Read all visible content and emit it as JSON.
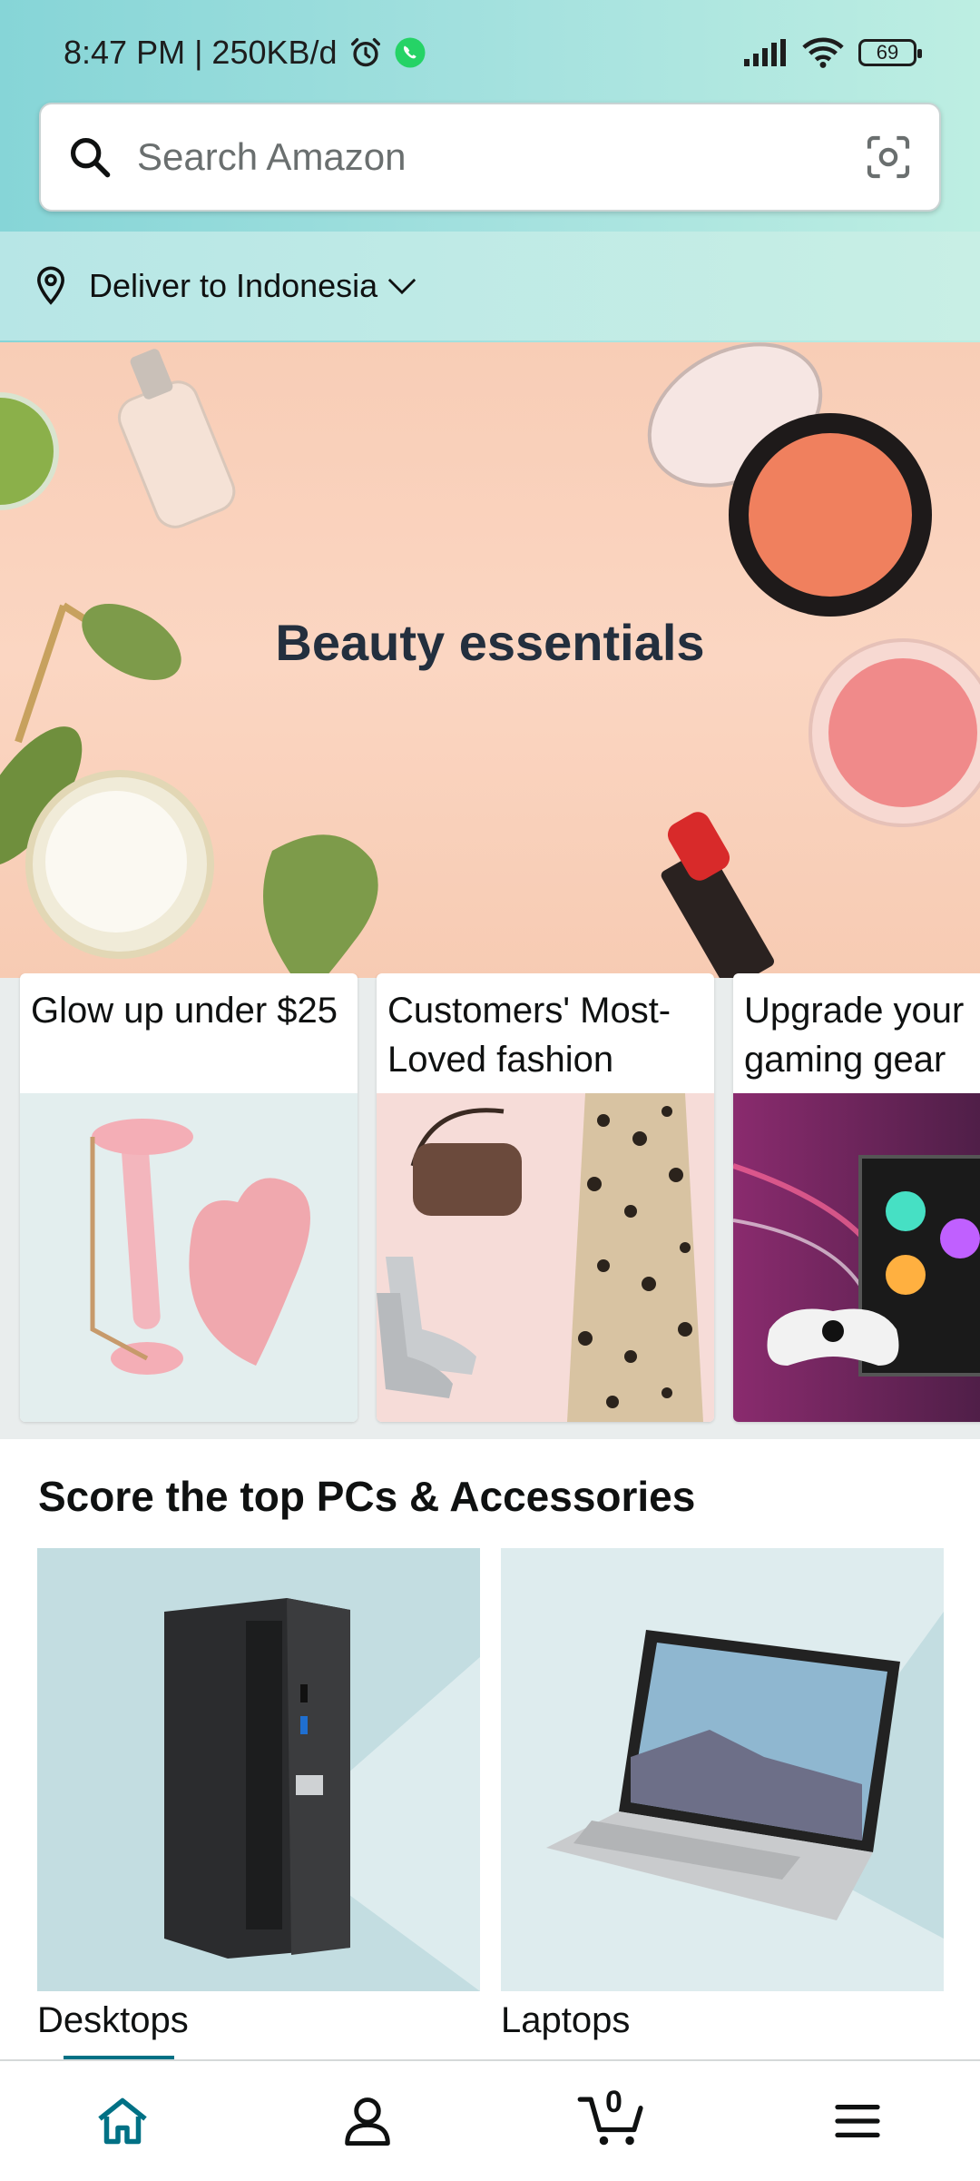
{
  "status_bar": {
    "time_info": "8:47 PM | 250KB/d",
    "battery": "69"
  },
  "search": {
    "placeholder": "Search Amazon"
  },
  "delivery": {
    "label": "Deliver to Indonesia"
  },
  "hero": {
    "title": "Beauty essentials"
  },
  "cards": [
    {
      "title": "Glow up under $25"
    },
    {
      "title": "Customers' Most-Loved fashion"
    },
    {
      "title": "Upgrade your gaming gear"
    }
  ],
  "section": {
    "title": "Score the top PCs & Accessories",
    "tiles": [
      {
        "label": "Desktops"
      },
      {
        "label": "Laptops"
      }
    ]
  },
  "bottom_nav": {
    "cart_count": "0",
    "items": [
      "home-icon",
      "account-icon",
      "cart-icon",
      "menu-icon"
    ]
  },
  "colors": {
    "accent": "#007185",
    "header_gradient_start": "#86d5d7",
    "header_gradient_end": "#bdeee2"
  }
}
